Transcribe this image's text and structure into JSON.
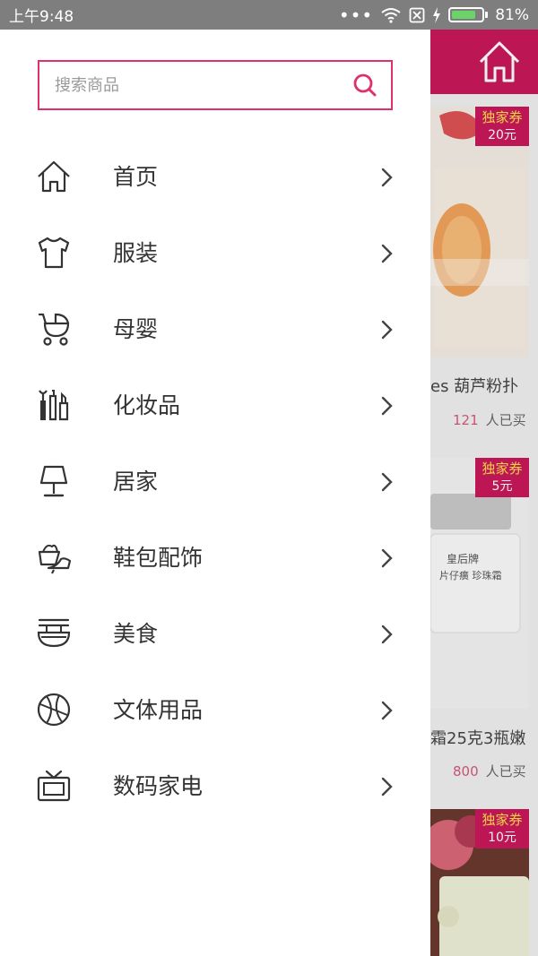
{
  "status_bar": {
    "time": "上午9:48",
    "battery": "81%",
    "battery_level": 0.81
  },
  "search": {
    "placeholder": "搜索商品"
  },
  "menu": {
    "items": [
      {
        "label": "首页",
        "icon": "home-icon"
      },
      {
        "label": "服装",
        "icon": "tshirt-icon"
      },
      {
        "label": "母婴",
        "icon": "stroller-icon"
      },
      {
        "label": "化妆品",
        "icon": "cosmetics-icon"
      },
      {
        "label": "居家",
        "icon": "lamp-icon"
      },
      {
        "label": "鞋包配饰",
        "icon": "shoes-bag-icon"
      },
      {
        "label": "美食",
        "icon": "food-bowl-icon"
      },
      {
        "label": "文体用品",
        "icon": "basketball-icon"
      },
      {
        "label": "数码家电",
        "icon": "tv-icon"
      }
    ]
  },
  "background": {
    "products": [
      {
        "badge_title": "独家券",
        "badge_amount": "20元",
        "title": "es 葫芦粉扑",
        "count": "121",
        "count_suffix": "人已买"
      },
      {
        "badge_title": "独家券",
        "badge_amount": "5元",
        "title": "霜25克3瓶嫩",
        "count": "800",
        "count_suffix": "人已买"
      },
      {
        "badge_title": "独家券",
        "badge_amount": "10元"
      }
    ]
  },
  "colors": {
    "accent": "#c8195a",
    "search_border": "#e0306b",
    "badge_text": "#ffe14a",
    "icon_stroke": "#333333"
  }
}
